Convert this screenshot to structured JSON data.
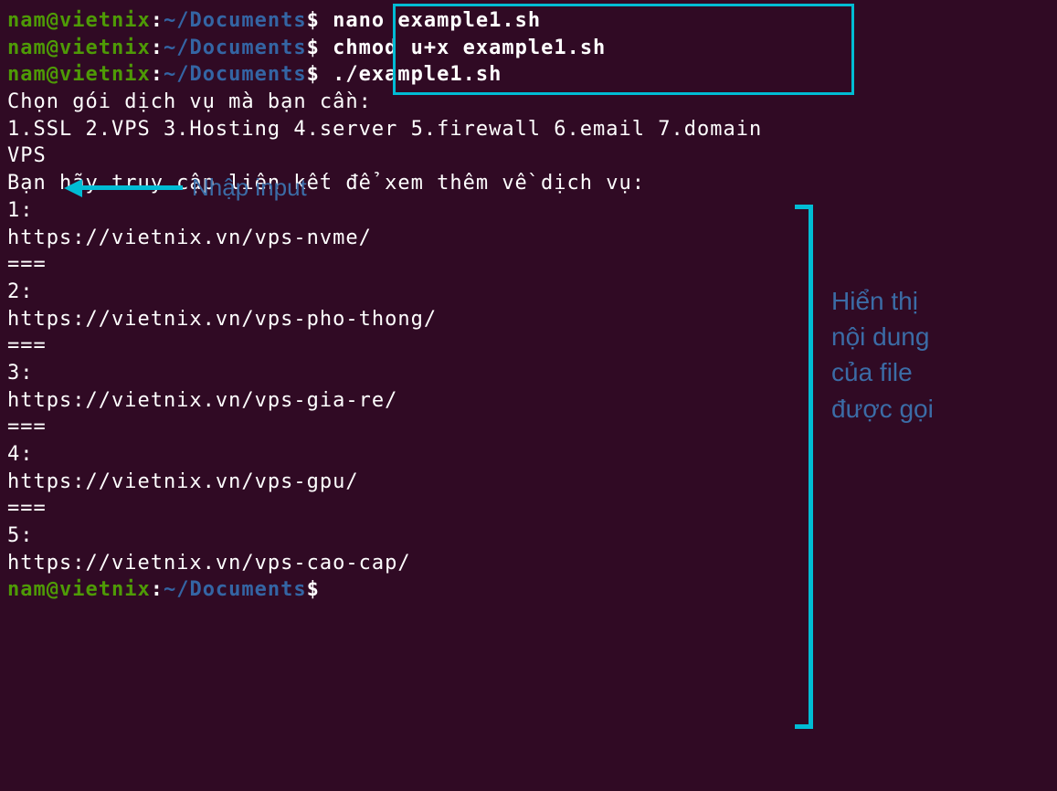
{
  "prompt": {
    "user": "nam@vietnix",
    "colon": ":",
    "path": "~/Documents",
    "dollar": "$"
  },
  "commands": {
    "cmd1": "nano example1.sh",
    "cmd2": "chmod u+x example1.sh",
    "cmd3": "./example1.sh"
  },
  "output": {
    "prompt_text": "Chọn gói dịch vụ mà bạn cần:",
    "options": "1.SSL 2.VPS 3.Hosting 4.server 5.firewall 6.email 7.domain",
    "user_input": "VPS",
    "access_text": "Bạn hãy truy cập liên kết để xem thêm về dịch vụ:",
    "items": [
      {
        "num": "1:",
        "url": "https://vietnix.vn/vps-nvme/"
      },
      {
        "num": "2:",
        "url": "https://vietnix.vn/vps-pho-thong/"
      },
      {
        "num": "3:",
        "url": "https://vietnix.vn/vps-gia-re/"
      },
      {
        "num": "4:",
        "url": "https://vietnix.vn/vps-gpu/"
      },
      {
        "num": "5:",
        "url": "https://vietnix.vn/vps-cao-cap/"
      }
    ],
    "separator": "==="
  },
  "annotations": {
    "input_label": "Nhập input",
    "bracket_label": "Hiển thị nội dung của file được gọi"
  }
}
